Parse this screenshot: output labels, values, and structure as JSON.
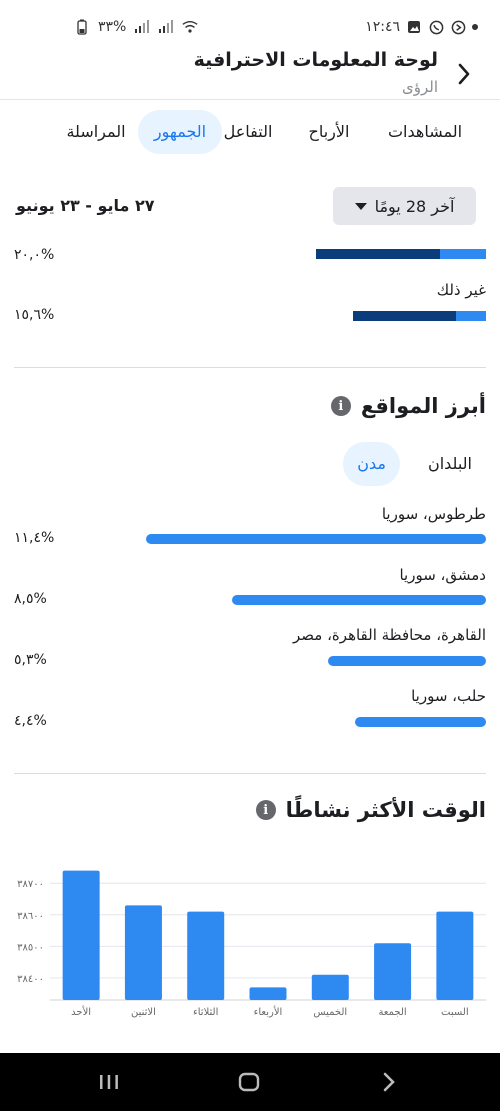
{
  "status": {
    "time": "١٢:٤٦",
    "battery": "٣٣%"
  },
  "header": {
    "title": "لوحة المعلومات الاحترافية",
    "subtitle": "الرؤى"
  },
  "tabs": [
    {
      "label": "المشاهدات",
      "active": false
    },
    {
      "label": "الأرباح",
      "active": false
    },
    {
      "label": "التفاعل",
      "active": false
    },
    {
      "label": "الجمهور",
      "active": true
    },
    {
      "label": "المراسلة",
      "active": false
    }
  ],
  "range": {
    "button_label": "آخر 28 يومًا",
    "dates": "٢٧ مايو - ٢٣ يونيو"
  },
  "gender": [
    {
      "label": "",
      "percent": "٢٠,٠%",
      "share": 0.2
    },
    {
      "label": "غير ذلك",
      "percent": "١٥,٦%",
      "share": 0.156
    }
  ],
  "locations": {
    "title": "أبرز المواقع",
    "tab_countries": "البلدان",
    "tab_cities": "مدن",
    "items": [
      {
        "name": "طرطوس، سوريا",
        "percent": "١١,٤%",
        "value": 11.4
      },
      {
        "name": "دمشق، سوريا",
        "percent": "٨,٥%",
        "value": 8.5
      },
      {
        "name": "القاهرة، محافظة القاهرة، مصر",
        "percent": "٥,٣%",
        "value": 5.3
      },
      {
        "name": "حلب، سوريا",
        "percent": "٤,٤%",
        "value": 4.4
      }
    ]
  },
  "active_time": {
    "title": "الوقت الأكثر نشاطًا"
  },
  "colors": {
    "accent": "#1877f2",
    "bar": "#2e89f0",
    "dark_bar": "#0a3d7a"
  },
  "chart_data": {
    "type": "bar",
    "categories": [
      "الأحد",
      "الاثنين",
      "الثلاثاء",
      "الأربعاء",
      "الخميس",
      "الجمعة",
      "السبت"
    ],
    "values": [
      38740,
      38630,
      38610,
      38370,
      38410,
      38510,
      38610
    ],
    "yticks": [
      38400,
      38500,
      38600,
      38700
    ],
    "ytick_labels": [
      "٣٨٤٠٠",
      "٣٨٥٠٠",
      "٣٨٦٠٠",
      "٣٨٧٠٠"
    ],
    "ylim": [
      38330,
      38780
    ],
    "grid": true
  }
}
